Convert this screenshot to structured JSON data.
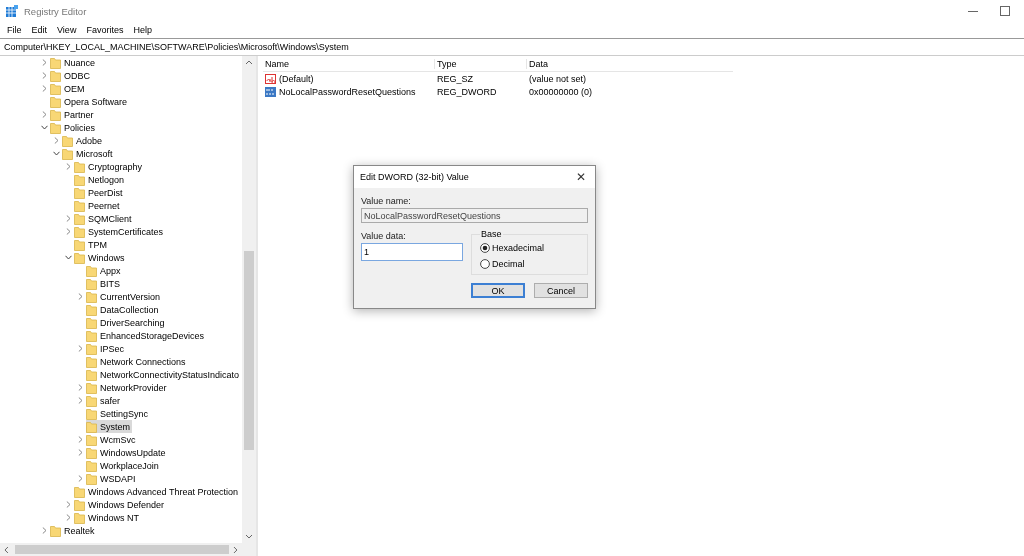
{
  "window": {
    "title": "Registry Editor"
  },
  "menu": [
    {
      "label": "File"
    },
    {
      "label": "Edit"
    },
    {
      "label": "View"
    },
    {
      "label": "Favorites"
    },
    {
      "label": "Help"
    }
  ],
  "address": {
    "value": "Computer\\HKEY_LOCAL_MACHINE\\SOFTWARE\\Policies\\Microsoft\\Windows\\System"
  },
  "tree": [
    {
      "kind": "branch",
      "label": "Nuance",
      "expanded": false,
      "selected": false
    },
    {
      "kind": "branch",
      "label": "ODBC",
      "expanded": false,
      "selected": false
    },
    {
      "kind": "branch",
      "label": "OEM",
      "expanded": false,
      "selected": false
    },
    {
      "kind": "leaf",
      "label": "Opera Software",
      "selected": false
    },
    {
      "kind": "branch",
      "label": "Partner",
      "expanded": false,
      "selected": false
    },
    {
      "kind": "branch",
      "label": "Policies",
      "expanded": true,
      "selected": false,
      "children": [
        {
          "kind": "branch",
          "label": "Adobe",
          "expanded": false,
          "selected": false
        },
        {
          "kind": "branch",
          "label": "Microsoft",
          "expanded": true,
          "selected": false,
          "children": [
            {
              "kind": "branch",
              "label": "Cryptography",
              "expanded": false,
              "selected": false
            },
            {
              "kind": "leaf",
              "label": "Netlogon",
              "selected": false
            },
            {
              "kind": "leaf",
              "label": "PeerDist",
              "selected": false
            },
            {
              "kind": "leaf",
              "label": "Peernet",
              "selected": false
            },
            {
              "kind": "branch",
              "label": "SQMClient",
              "expanded": false,
              "selected": false
            },
            {
              "kind": "branch",
              "label": "SystemCertificates",
              "expanded": false,
              "selected": false
            },
            {
              "kind": "leaf",
              "label": "TPM",
              "selected": false
            },
            {
              "kind": "branch",
              "label": "Windows",
              "expanded": true,
              "selected": false,
              "children": [
                {
                  "kind": "leaf",
                  "label": "Appx",
                  "selected": false
                },
                {
                  "kind": "leaf",
                  "label": "BITS",
                  "selected": false
                },
                {
                  "kind": "branch",
                  "label": "CurrentVersion",
                  "expanded": false,
                  "selected": false
                },
                {
                  "kind": "leaf",
                  "label": "DataCollection",
                  "selected": false
                },
                {
                  "kind": "leaf",
                  "label": "DriverSearching",
                  "selected": false
                },
                {
                  "kind": "leaf",
                  "label": "EnhancedStorageDevices",
                  "selected": false
                },
                {
                  "kind": "branch",
                  "label": "IPSec",
                  "expanded": false,
                  "selected": false
                },
                {
                  "kind": "leaf",
                  "label": "Network Connections",
                  "selected": false
                },
                {
                  "kind": "leaf",
                  "label": "NetworkConnectivityStatusIndicato",
                  "selected": false
                },
                {
                  "kind": "branch",
                  "label": "NetworkProvider",
                  "expanded": false,
                  "selected": false
                },
                {
                  "kind": "branch",
                  "label": "safer",
                  "expanded": false,
                  "selected": false
                },
                {
                  "kind": "leaf",
                  "label": "SettingSync",
                  "selected": false
                },
                {
                  "kind": "leaf",
                  "label": "System",
                  "selected": true
                },
                {
                  "kind": "branch",
                  "label": "WcmSvc",
                  "expanded": false,
                  "selected": false
                },
                {
                  "kind": "branch",
                  "label": "WindowsUpdate",
                  "expanded": false,
                  "selected": false
                },
                {
                  "kind": "leaf",
                  "label": "WorkplaceJoin",
                  "selected": false
                },
                {
                  "kind": "branch",
                  "label": "WSDAPI",
                  "expanded": false,
                  "selected": false
                }
              ]
            },
            {
              "kind": "leaf",
              "label": "Windows Advanced Threat Protection",
              "selected": false
            },
            {
              "kind": "branch",
              "label": "Windows Defender",
              "expanded": false,
              "selected": false
            },
            {
              "kind": "branch",
              "label": "Windows NT",
              "expanded": false,
              "selected": false
            }
          ]
        }
      ]
    },
    {
      "kind": "branch",
      "label": "Realtek",
      "expanded": false,
      "selected": false
    }
  ],
  "table": {
    "columns": [
      "Name",
      "Type",
      "Data"
    ],
    "rows": [
      {
        "kind": "string",
        "name": "(Default)",
        "type": "REG_SZ",
        "data": "(value not set)"
      },
      {
        "kind": "binary",
        "name": "NoLocalPasswordResetQuestions",
        "type": "REG_DWORD",
        "data": "0x00000000 (0)"
      }
    ]
  },
  "dialog": {
    "title": "Edit DWORD (32-bit) Value",
    "close": "✕",
    "value_name_label": "Value name:",
    "value_name": "NoLocalPasswordResetQuestions",
    "value_data_label": "Value data:",
    "value_data": "1",
    "base_label": "Base",
    "base_options": [
      {
        "label": "Hexadecimal",
        "selected": true
      },
      {
        "label": "Decimal",
        "selected": false
      }
    ],
    "buttons": [
      {
        "label": "OK",
        "default": true
      },
      {
        "label": "Cancel",
        "default": false
      }
    ]
  }
}
